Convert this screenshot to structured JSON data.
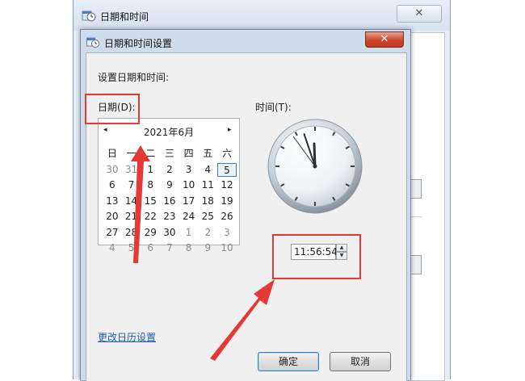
{
  "outer_window": {
    "title": "日期和时间",
    "close_glyph": "✕"
  },
  "dialog": {
    "title": "日期和时间设置",
    "close_glyph": "✕",
    "section_label": "设置日期和时间:",
    "date_label": "日期(D):",
    "time_label": "时间(T):"
  },
  "calendar": {
    "prev_glyph": "◂",
    "next_glyph": "▸",
    "month_year": "2021年6月",
    "weekdays": [
      "日",
      "一",
      "二",
      "三",
      "四",
      "五",
      "六"
    ],
    "weeks": [
      [
        {
          "d": "30",
          "m": true
        },
        {
          "d": "31",
          "m": true
        },
        {
          "d": "1"
        },
        {
          "d": "2"
        },
        {
          "d": "3"
        },
        {
          "d": "4"
        },
        {
          "d": "5",
          "sel": true
        }
      ],
      [
        {
          "d": "6"
        },
        {
          "d": "7"
        },
        {
          "d": "8"
        },
        {
          "d": "9"
        },
        {
          "d": "10"
        },
        {
          "d": "11"
        },
        {
          "d": "12"
        }
      ],
      [
        {
          "d": "13"
        },
        {
          "d": "14"
        },
        {
          "d": "15"
        },
        {
          "d": "16"
        },
        {
          "d": "17"
        },
        {
          "d": "18"
        },
        {
          "d": "19"
        }
      ],
      [
        {
          "d": "20"
        },
        {
          "d": "21"
        },
        {
          "d": "22"
        },
        {
          "d": "23"
        },
        {
          "d": "24"
        },
        {
          "d": "25"
        },
        {
          "d": "26"
        }
      ],
      [
        {
          "d": "27"
        },
        {
          "d": "28"
        },
        {
          "d": "29"
        },
        {
          "d": "30"
        },
        {
          "d": "1",
          "m": true
        },
        {
          "d": "2",
          "m": true
        },
        {
          "d": "3",
          "m": true
        }
      ],
      [
        {
          "d": "4",
          "m": true
        },
        {
          "d": "5",
          "m": true
        },
        {
          "d": "6",
          "m": true
        },
        {
          "d": "7",
          "m": true
        },
        {
          "d": "8",
          "m": true
        },
        {
          "d": "9",
          "m": true
        },
        {
          "d": "10",
          "m": true
        }
      ]
    ]
  },
  "clock": {
    "hour": 11,
    "minute": 56,
    "second": 54
  },
  "time_field": {
    "value": "11:56:54",
    "up_glyph": "▲",
    "down_glyph": "▼"
  },
  "change_calendar_link": "更改日历设置",
  "buttons": {
    "ok": "确定",
    "cancel": "取消"
  },
  "colors": {
    "annotation": "#e53935",
    "link": "#1a5fb4",
    "selected_day_border": "#3c7fb1"
  }
}
